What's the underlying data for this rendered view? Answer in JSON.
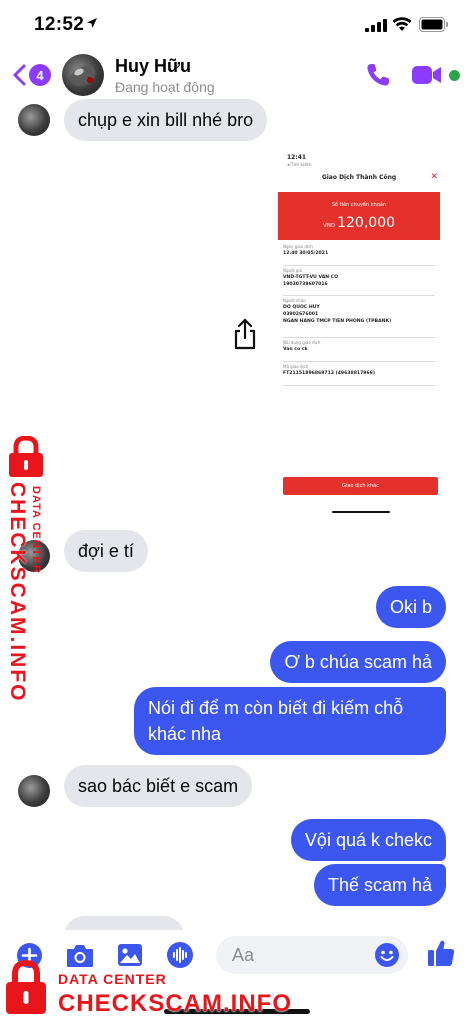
{
  "status_bar": {
    "time": "12:52"
  },
  "header": {
    "unread_count": "4",
    "contact_name": "Huy Hữu",
    "contact_status": "Đang hoạt động",
    "icons": [
      "back-icon",
      "phone-icon",
      "video-camera-icon"
    ],
    "accent_color": "#8b3cff"
  },
  "messages": {
    "m1": "chụp e xin bill nhé bro",
    "m2": "đợi e tí",
    "m3": "Oki b",
    "m4": "Ơ b chúa scam hả",
    "m5": "Nói đi để m còn biết đi kiếm chỗ khác nha",
    "m6": "sao bác biết e scam",
    "m7": "Vội quá k chekc",
    "m8": "Thế scam hả"
  },
  "colors": {
    "outgoing_bubble": "#3c57ef",
    "incoming_bubble": "#e4e6eb"
  },
  "shared_image": {
    "time": "12:41",
    "back": "◂ Tìm kiếm",
    "title": "Giao Dịch Thành Công",
    "amount_label": "Số tiền chuyển khoản",
    "currency": "VND",
    "amount": "120,000",
    "fields": [
      {
        "label": "Ngày giao dịch",
        "lines": [
          "12:40 30/05/2021"
        ]
      },
      {
        "label": "Người gửi",
        "lines": [
          "VND-TGTT-VU VAN CO",
          "19030739607016"
        ]
      },
      {
        "label": "Người nhận",
        "lines": [
          "DO QUOC HUY",
          "03902676001",
          "NGAN HANG TMCP TIEN PHONG (TPBANK)"
        ]
      },
      {
        "label": "Nội dung giao dịch",
        "lines": [
          "Van co ck"
        ]
      },
      {
        "label": "Mã giao dịch",
        "lines": [
          "FT21151896869712 (49638817966)"
        ]
      }
    ],
    "button": "Giao dịch khác"
  },
  "composer": {
    "placeholder": "Aa",
    "icons": [
      "plus-icon",
      "camera-icon",
      "image-icon",
      "microphone-icon",
      "emoji-icon",
      "thumbs-up-icon"
    ]
  },
  "watermark": {
    "line1": "DATA CENTER",
    "line2": "CHECKSCAM.INFO",
    "color": "#e8151b"
  }
}
